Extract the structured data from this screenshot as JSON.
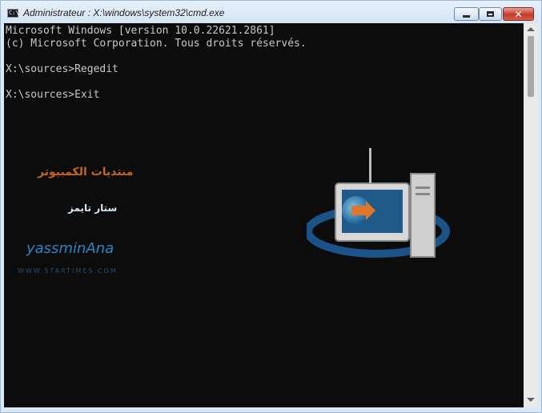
{
  "window": {
    "title": "Administrateur : X:\\windows\\system32\\cmd.exe",
    "icon": "cmd-icon",
    "icon_text": "C:\\"
  },
  "controls": {
    "minimize_icon": "minimize-icon",
    "maximize_icon": "maximize-icon",
    "close_icon": "close-icon",
    "close_glyph": "✕"
  },
  "console": {
    "background": "#0c0c0c",
    "foreground": "#c8c8c8",
    "lines": [
      "Microsoft Windows [version 10.0.22621.2861]",
      "(c) Microsoft Corporation. Tous droits réservés.",
      "",
      "X:\\sources>Regedit",
      "",
      "X:\\sources>Exit"
    ]
  },
  "watermark": {
    "logo_text": "yassminAna",
    "url_text": "WWW.STARTIMES.COM",
    "arabic_top": "منتديات الكمبيوتر",
    "arabic_mid": "ستار تايمز"
  }
}
